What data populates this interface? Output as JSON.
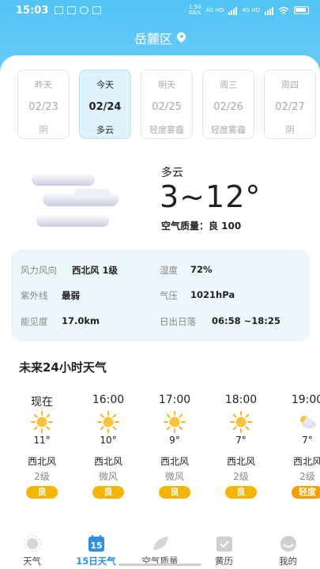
{
  "status_bar": {
    "time": "15:03",
    "network_speed": "1.50\nKB/s",
    "signal_1": "4G HD",
    "signal_2": "4G HD"
  },
  "location": "岳麓区",
  "days": [
    {
      "name": "昨天",
      "date": "02/23",
      "cond": "阴",
      "active": false
    },
    {
      "name": "今天",
      "date": "02/24",
      "cond": "多云",
      "active": true
    },
    {
      "name": "明天",
      "date": "02/25",
      "cond": "轻度雾霾",
      "active": false
    },
    {
      "name": "周三",
      "date": "02/26",
      "cond": "轻度雾霾",
      "active": false
    },
    {
      "name": "周四",
      "date": "02/27",
      "cond": "阴",
      "active": false
    }
  ],
  "current": {
    "cond": "多云",
    "temp": "3~12°",
    "aqi": "空气质量：良 100",
    "icon": "cloudy-icon"
  },
  "details": {
    "wind_label": "风力风向",
    "wind_value": "西北风 1级",
    "humidity_label": "湿度",
    "humidity_value": "72%",
    "uv_label": "紫外线",
    "uv_value": "最弱",
    "pressure_label": "气压",
    "pressure_value": "1021hPa",
    "visibility_label": "能见度",
    "visibility_value": "17.0km",
    "sun_label": "日出日落",
    "sun_value": "06:58 ~18:25"
  },
  "hourly_title": "未来24小时天气",
  "hourly": [
    {
      "time": "现在",
      "icon": "sun-icon",
      "temp": "11°",
      "wdir": "西北风",
      "wlvl": "2级",
      "aqi": "良",
      "aqi_color": "#f5b400"
    },
    {
      "time": "16:00",
      "icon": "sun-icon",
      "temp": "10°",
      "wdir": "西北风",
      "wlvl": "微风",
      "aqi": "良",
      "aqi_color": "#f5b400"
    },
    {
      "time": "17:00",
      "icon": "sun-icon",
      "temp": "9°",
      "wdir": "西北风",
      "wlvl": "微风",
      "aqi": "良",
      "aqi_color": "#f5b400"
    },
    {
      "time": "18:00",
      "icon": "sun-icon",
      "temp": "7°",
      "wdir": "西北风",
      "wlvl": "2级",
      "aqi": "良",
      "aqi_color": "#f5b400"
    },
    {
      "time": "19:00",
      "icon": "night-cloudy-icon",
      "temp": "7°",
      "wdir": "西北风",
      "wlvl": "2级",
      "aqi": "轻度",
      "aqi_color": "#f5a000"
    }
  ],
  "tabs": [
    {
      "label": "天气",
      "icon": "sun-icon",
      "active": false
    },
    {
      "label": "15日天气",
      "icon": "calendar-15-icon",
      "active": true
    },
    {
      "label": "空气质量",
      "icon": "leaf-icon",
      "active": false
    },
    {
      "label": "黄历",
      "icon": "almanac-icon",
      "active": false
    },
    {
      "label": "我的",
      "icon": "profile-icon",
      "active": false
    }
  ],
  "colors": {
    "sky": "#52c3f5",
    "accent": "#2f8fe0",
    "aqi_good": "#f5b400",
    "details_bg": "#ecf7fc"
  }
}
